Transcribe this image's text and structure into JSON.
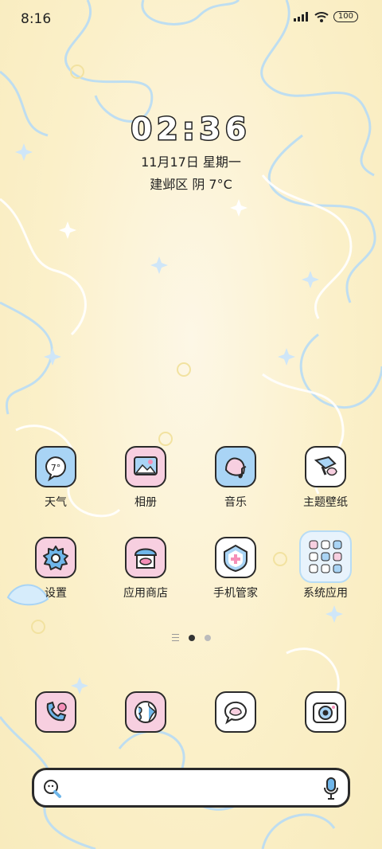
{
  "status_bar": {
    "time": "8:16",
    "battery": "100"
  },
  "clock": {
    "time": "02:36",
    "date": "11月17日 星期一",
    "weather": "建邺区 阴 7°C"
  },
  "weather_icon_text": "7°",
  "apps_row1": [
    {
      "label": "天气"
    },
    {
      "label": "相册"
    },
    {
      "label": "音乐"
    },
    {
      "label": "主题壁纸"
    }
  ],
  "apps_row2": [
    {
      "label": "设置"
    },
    {
      "label": "应用商店"
    },
    {
      "label": "手机管家"
    },
    {
      "label": "系统应用"
    }
  ],
  "page_indicator": {
    "pages": 2,
    "active": 1
  },
  "dock": [
    "phone-icon",
    "browser-icon",
    "messages-icon",
    "camera-icon"
  ],
  "search": {
    "placeholder": ""
  },
  "colors": {
    "accent_pink": "#f7cfe0",
    "accent_blue": "#a9d4f5",
    "outline": "#2a2a2a"
  }
}
